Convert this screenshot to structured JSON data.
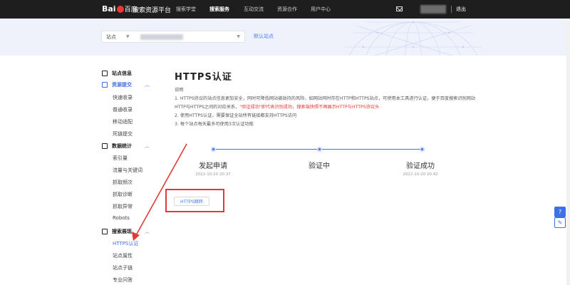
{
  "nav": {
    "logo_text": "Bai",
    "logo_du": "百度",
    "platform": "搜索资源平台",
    "items": [
      "搜索学堂",
      "搜索服务",
      "互动交流",
      "资源合作",
      "用户中心"
    ],
    "logout": "退出"
  },
  "banner": {
    "site_label": "站点",
    "default_site": "默认站点"
  },
  "sidebar": {
    "groups": [
      {
        "label": "站点信息"
      },
      {
        "label": "资源提交",
        "items": [
          "快速收录",
          "普通收录",
          "移动适配",
          "死链提交"
        ]
      },
      {
        "label": "数据统计",
        "items": [
          "索引量",
          "流量与关键词",
          "抓取频次",
          "抓取诊断",
          "抓取异常",
          "Robots"
        ]
      },
      {
        "label": "搜索展现",
        "items": [
          "HTTPS认证",
          "站点属性",
          "站点子链",
          "专业问答"
        ]
      }
    ]
  },
  "main": {
    "title": "HTTPS认证",
    "note_title": "说明",
    "note_1": "1. HTTPS协议的站点信息更加安全，同时可降低网站被劫持的风险，如网站同时存在HTTP和HTTPS站点，可使用本工具进行认证，便于百度搜索识别网站",
    "note_1b_pre": "HTTP与HTTPS之间的对应关系，",
    "note_1b_red": "\"验证成功\"即代表识别成功，搜索端快照不再展示HTTP与HTTPS协议头",
    "note_2": "2. 使用HTTPS认证，需要保证全站所有链接都支持HTTPS访问",
    "note_3": "3. 每个站点每天最多可使用3次认证功能",
    "steps": [
      {
        "label": "发起申请",
        "time": "2022-10-20 20:37"
      },
      {
        "label": "验证中",
        "time": ""
      },
      {
        "label": "验证成功",
        "time": "2022-10-20 20:42"
      }
    ],
    "jump_button": "HTTPS跳转"
  },
  "colors": {
    "accent": "#3f6fe8",
    "annotation": "#e53935",
    "nav_bg": "#1e1e1e"
  }
}
